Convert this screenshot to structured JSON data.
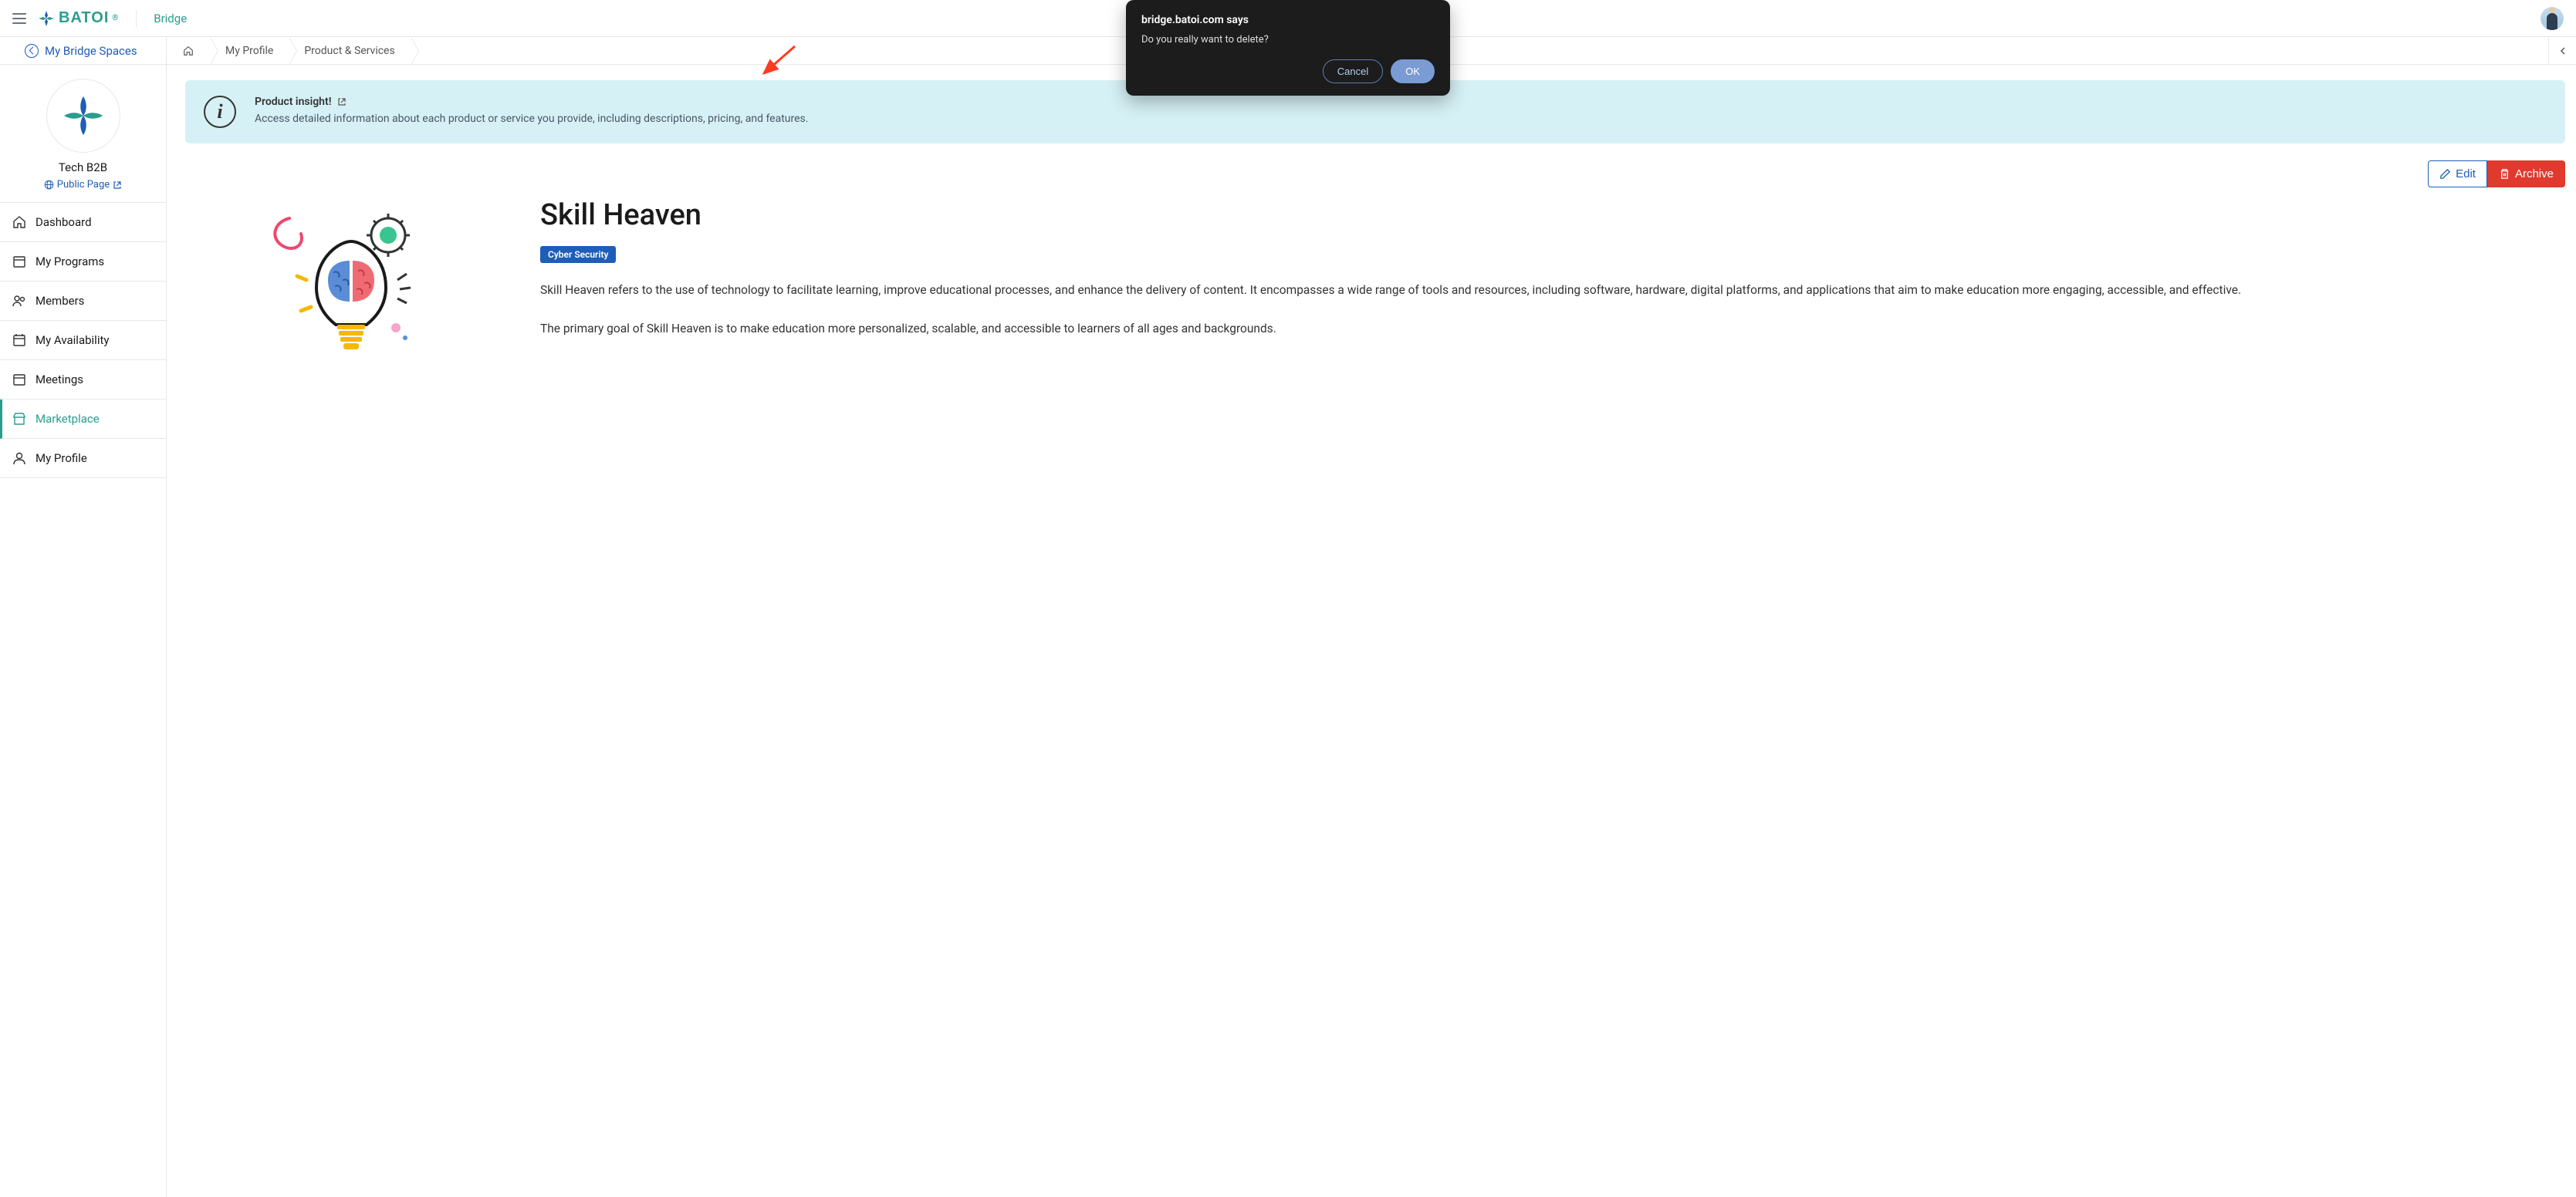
{
  "header": {
    "logo_text": "BATOI",
    "app_name": "Bridge"
  },
  "breadcrumb": {
    "back_label": "My Bridge Spaces",
    "items": [
      "My Profile",
      "Product & Services"
    ]
  },
  "sidebar": {
    "profile_name": "Tech B2B",
    "public_page_label": "Public Page",
    "nav": [
      {
        "label": "Dashboard",
        "icon": "home"
      },
      {
        "label": "My Programs",
        "icon": "calendar"
      },
      {
        "label": "Members",
        "icon": "users"
      },
      {
        "label": "My Availability",
        "icon": "calendar"
      },
      {
        "label": "Meetings",
        "icon": "calendar"
      },
      {
        "label": "Marketplace",
        "icon": "store",
        "active": true
      },
      {
        "label": "My Profile",
        "icon": "user"
      }
    ]
  },
  "insight": {
    "title": "Product insight!",
    "desc": "Access detailed information about each product or service you provide, including descriptions, pricing, and features."
  },
  "actions": {
    "edit": "Edit",
    "archive": "Archive"
  },
  "product": {
    "title": "Skill Heaven",
    "tag": "Cyber Security",
    "para1": "Skill Heaven refers to the use of technology to facilitate learning, improve educational processes, and enhance the delivery of content. It encompasses a wide range of tools and resources, including software, hardware, digital platforms, and applications that aim to make education more engaging, accessible, and effective.",
    "para2": "The primary goal of Skill Heaven is to make education more personalized, scalable, and accessible to learners of all ages and backgrounds."
  },
  "dialog": {
    "origin": "bridge.batoi.com says",
    "message": "Do you really want to delete?",
    "cancel": "Cancel",
    "ok": "OK"
  }
}
